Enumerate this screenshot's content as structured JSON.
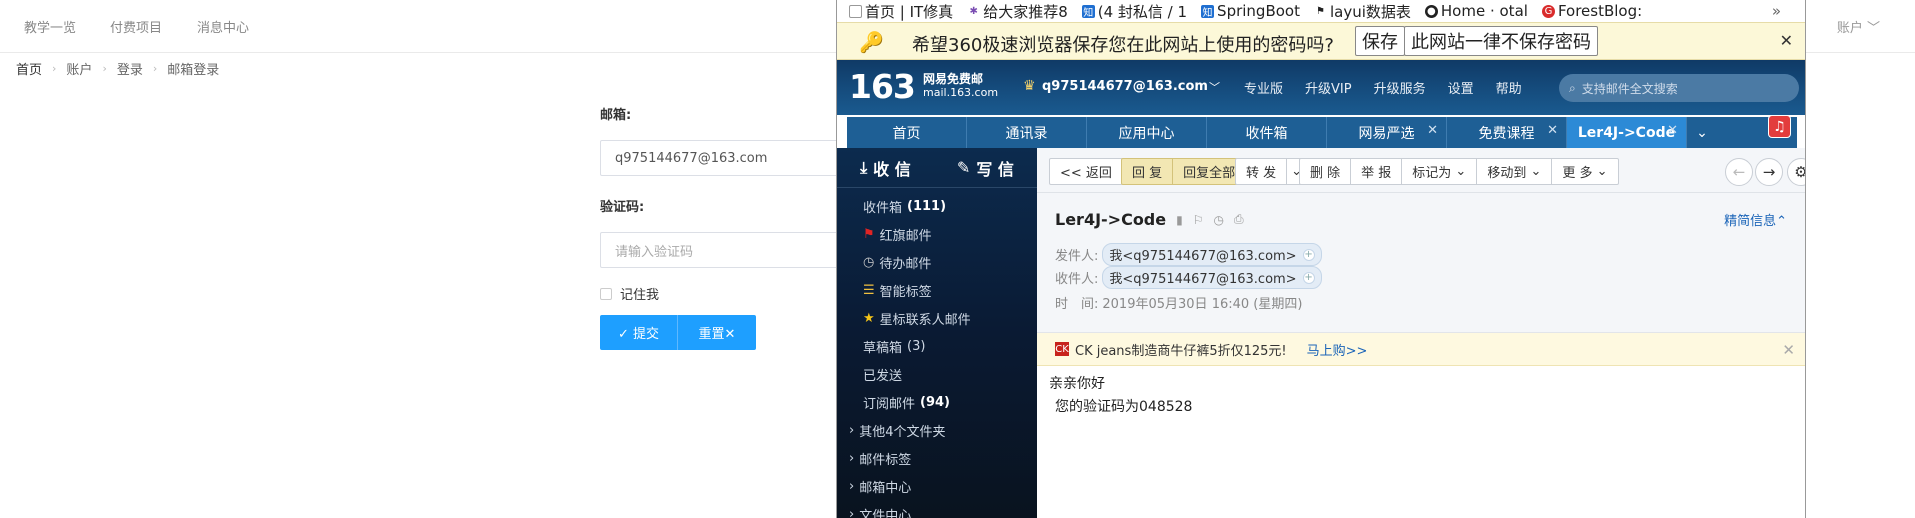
{
  "bg": {
    "nav": [
      "教学一览",
      "付费项目",
      "消息中心"
    ],
    "account": "账户 ﹀",
    "breadcrumb": [
      "首页",
      "账户",
      "登录",
      "邮箱登录"
    ],
    "form": {
      "email_label": "邮箱:",
      "email_value": "q975144677@163.com",
      "code_label": "验证码:",
      "code_placeholder": "请输入验证码",
      "remember": "记住我",
      "submit": "✓ 提交",
      "reset": "重置✕"
    }
  },
  "browser": {
    "bookmarks": [
      {
        "icon": "page-icon",
        "label": "首页 | IT修真"
      },
      {
        "icon": "bug-icon",
        "label": "给大家推荐8"
      },
      {
        "icon": "zhihu-icon",
        "label": "(4 封私信 / 1"
      },
      {
        "icon": "zhihu-icon",
        "label": "SpringBoot"
      },
      {
        "icon": "layui-icon",
        "label": "layui数据表"
      },
      {
        "icon": "github-icon",
        "label": "Home · otal"
      },
      {
        "icon": "forest-icon",
        "label": "ForestBlog:"
      }
    ],
    "more": "»",
    "password_bar": {
      "message": "希望360极速浏览器保存您在此网站上使用的密码吗?",
      "save": "保存",
      "never": "此网站一律不保存密码",
      "close": "✕"
    }
  },
  "mail": {
    "logo": "163",
    "logo_title": "网易免费邮",
    "logo_domain": "mail.163.com",
    "user": "q975144677@163.com",
    "header_links": [
      "专业版",
      "升级VIP",
      "升级服务",
      "设置",
      "帮助"
    ],
    "search_placeholder": "支持邮件全文搜索",
    "tabs": [
      "首页",
      "通讯录",
      "应用中心",
      "收件箱",
      "网易严选",
      "免费课程",
      "Ler4J->Code"
    ],
    "sidebar": {
      "receive": "收 信",
      "write": "写 信",
      "items": [
        {
          "label": "收件箱",
          "count": "(111)"
        },
        {
          "label": "红旗邮件",
          "count": ""
        },
        {
          "label": "待办邮件",
          "count": ""
        },
        {
          "label": "智能标签",
          "count": ""
        },
        {
          "label": "星标联系人邮件",
          "count": ""
        },
        {
          "label": "草稿箱",
          "count": "(3)"
        },
        {
          "label": "已发送",
          "count": ""
        },
        {
          "label": "订阅邮件",
          "count": "(94)"
        },
        {
          "label": "其他4个文件夹",
          "count": ""
        },
        {
          "label": "邮件标签",
          "count": ""
        },
        {
          "label": "邮箱中心",
          "count": ""
        },
        {
          "label": "文件中心",
          "count": ""
        }
      ]
    },
    "toolbar": {
      "back": "<< 返回",
      "reply": "回 复",
      "reply_all": "回复全部",
      "forward": "转 发",
      "delete": "删 除",
      "report": "举 报",
      "mark": "标记为",
      "move": "移动到",
      "more": "更 多"
    },
    "message": {
      "subject": "Ler4J->Code",
      "brief": "精简信息",
      "from_label": "发件人:",
      "from": "我<q975144677@163.com>",
      "to_label": "收件人:",
      "to": "我<q975144677@163.com>",
      "time_label": "时　间:",
      "time": "2019年05月30日 16:40 (星期四)",
      "ad": "CK jeans制造商牛仔裤5折仅125元!",
      "ad_link": "马上购>>",
      "greeting": "亲亲你好",
      "body": "您的验证码为048528"
    }
  }
}
